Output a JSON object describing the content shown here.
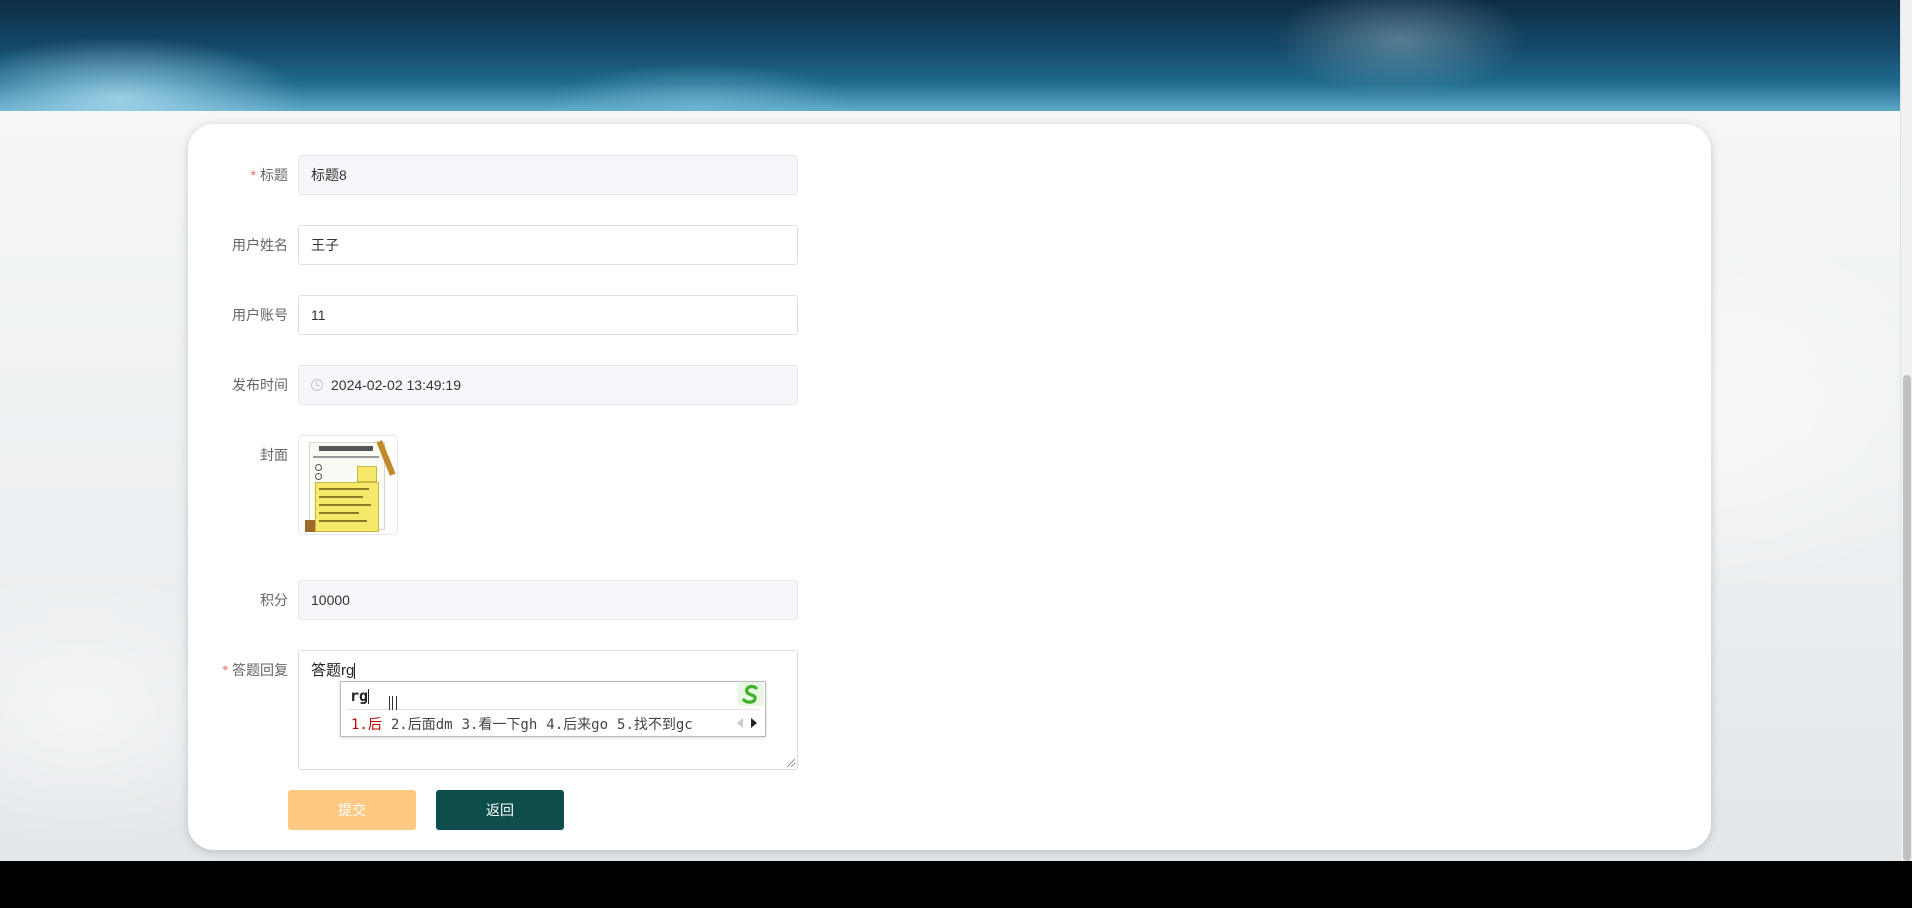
{
  "form": {
    "title": {
      "label": "标题",
      "required": "*",
      "value": "标题8"
    },
    "user_name": {
      "label": "用户姓名",
      "value": "王子"
    },
    "user_account": {
      "label": "用户账号",
      "value": "11"
    },
    "publish_time": {
      "label": "发布时间",
      "value": "2024-02-02 13:49:19"
    },
    "cover": {
      "label": "封面"
    },
    "points": {
      "label": "积分",
      "value": "10000"
    },
    "answer_reply": {
      "label": "答题回复",
      "required": "*",
      "value": "答题rg"
    }
  },
  "ime": {
    "composition": "rg",
    "candidates": [
      "1.后",
      "2.后面dm",
      "3.看一下gh",
      "4.后来go",
      "5.找不到gc"
    ]
  },
  "buttons": {
    "submit": "提交",
    "back": "返回"
  },
  "colors": {
    "submit_button": "#ffc983",
    "back_button": "#0d4d4b",
    "required_mark": "#f56c6c",
    "ime_first_candidate": "#c00000"
  }
}
